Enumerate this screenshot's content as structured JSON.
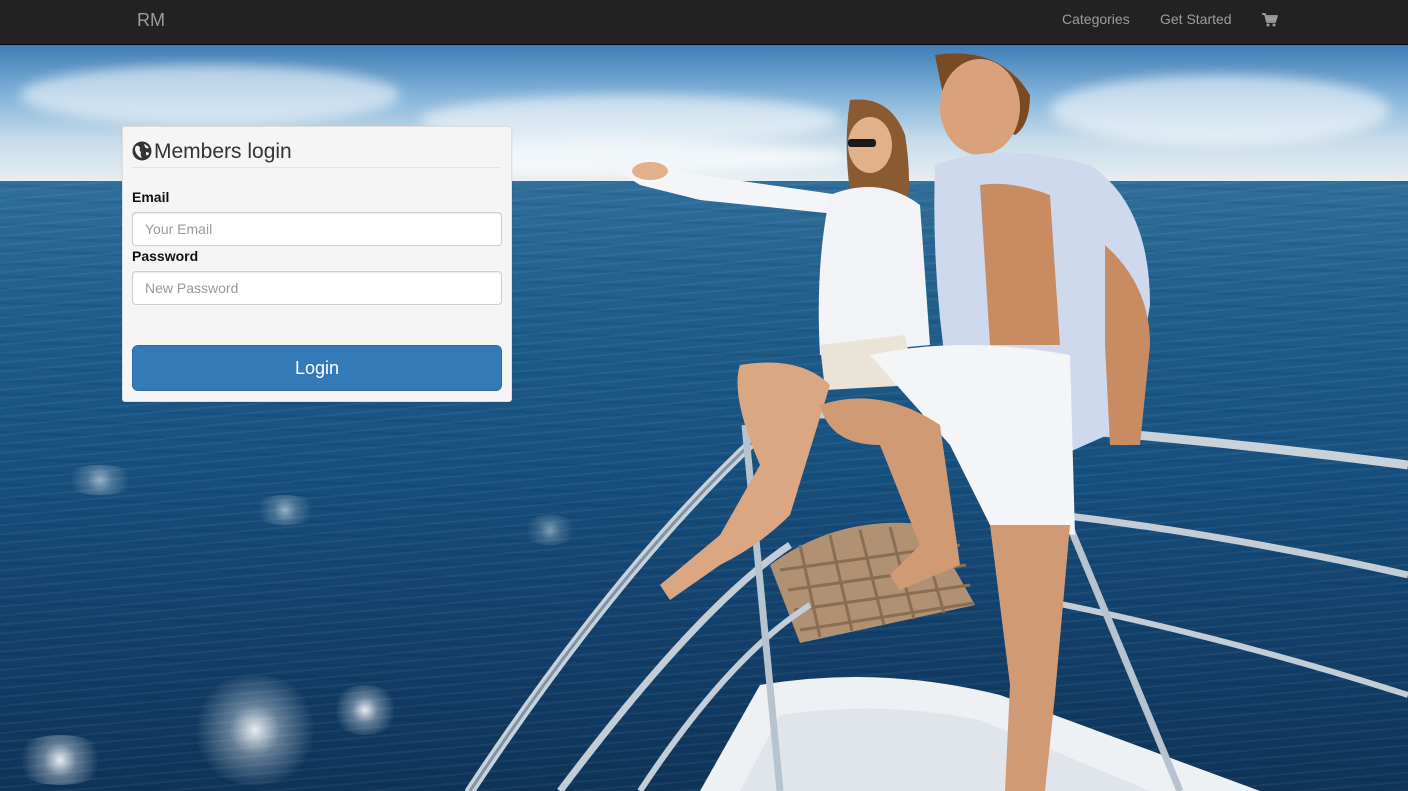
{
  "navbar": {
    "brand": "RM",
    "links": [
      {
        "label": "Categories"
      },
      {
        "label": "Get Started"
      }
    ],
    "cart_icon": "shopping-cart-icon"
  },
  "login": {
    "title": "Members login",
    "title_icon": "globe-icon",
    "email_label": "Email",
    "email_placeholder": "Your Email",
    "email_value": "",
    "password_label": "Password",
    "password_placeholder": "New Password",
    "password_value": "",
    "button_label": "Login"
  },
  "colors": {
    "navbar_bg": "#222222",
    "nav_text": "#9d9d9d",
    "panel_bg": "#f5f5f5",
    "primary_button": "#337ab7",
    "button_text": "#ffffff"
  },
  "background": {
    "description_icon": "yacht-couple-sea-photo"
  }
}
